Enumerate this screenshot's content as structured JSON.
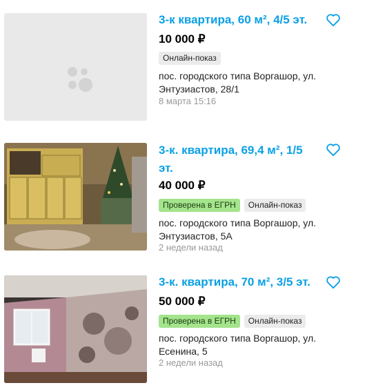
{
  "listings": [
    {
      "title": "3-к квартира, 60 м², 4/5 эт.",
      "price": "10 000 ₽",
      "badges": [
        "Онлайн-показ"
      ],
      "address_line1": "пос. городского типа Воргашор, ул.",
      "address_line2": "Энтузиастов, 28/1",
      "date": "8 марта 15:16",
      "has_photo": false
    },
    {
      "title_line1": "3-к. квартира, 69,4 м², 1/5",
      "title_line2": "эт.",
      "price": "40 000 ₽",
      "badges": [
        "Проверена в ЕГРН",
        "Онлайн-показ"
      ],
      "address_line1": "пос. городского типа Воргашор, ул.",
      "address_line2": "Энтузиастов, 5А",
      "date": "2 недели назад",
      "has_photo": true
    },
    {
      "title": "3-к. квартира, 70 м², 3/5 эт.",
      "price": "50 000 ₽",
      "badges": [
        "Проверена в ЕГРН",
        "Онлайн-показ"
      ],
      "address_line1": "пос. городского типа Воргашор, ул.",
      "address_line2": "Есенина, 5",
      "date": "2 недели назад",
      "has_photo": true
    }
  ],
  "colors": {
    "title": "#0aa0e6",
    "verified_badge": "#a4e48c",
    "neutral_badge": "#ebebeb",
    "date": "#999999"
  },
  "icons": {
    "favorite": "heart-outline-icon",
    "placeholder": "camera-placeholder-icon"
  }
}
